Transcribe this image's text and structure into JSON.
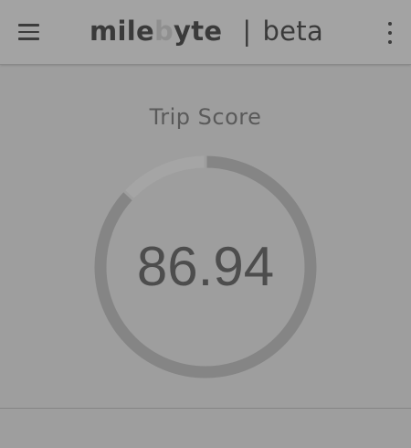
{
  "appbar": {
    "menu_icon": "hamburger-menu-icon",
    "brand_part1": "mile",
    "brand_faded": "b",
    "brand_part2": "yte",
    "separator": "|",
    "brand_suffix": "beta",
    "more_icon": "more-vertical-icon"
  },
  "main": {
    "title": "Trip Score",
    "score": "86.94"
  },
  "gauge": {
    "value": 86.94,
    "max": 100,
    "track_color": "#a5a5a5",
    "progress_color": "#858585",
    "background_color": "#9e9e9e"
  }
}
